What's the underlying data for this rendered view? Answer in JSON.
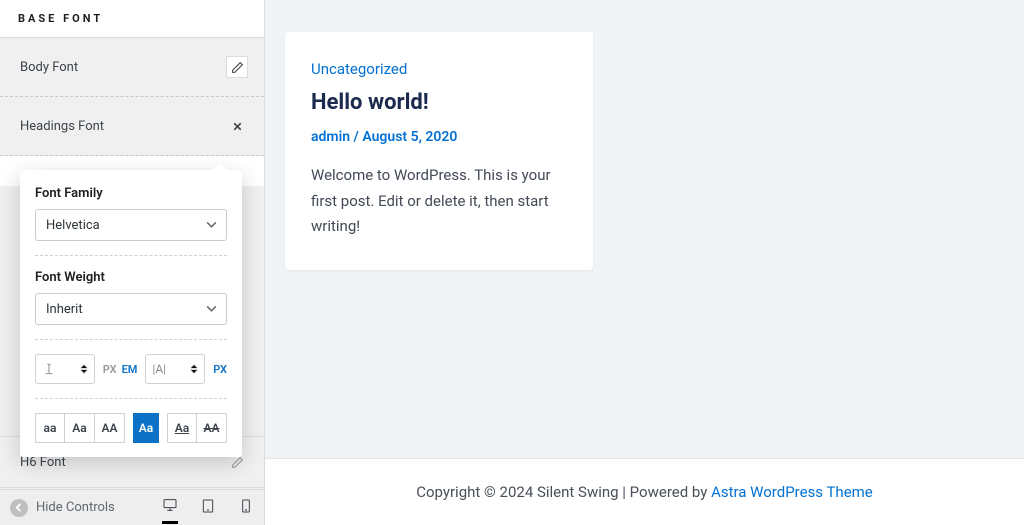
{
  "sidebar": {
    "section_title": "BASE FONT",
    "rows": {
      "body_font": "Body Font",
      "headings_font": "Headings Font",
      "h6_font": "H6 Font"
    }
  },
  "popover": {
    "font_family_label": "Font Family",
    "font_family_value": "Helvetica",
    "font_weight_label": "Font Weight",
    "font_weight_value": "Inherit",
    "units": {
      "px": "PX",
      "em": "EM"
    },
    "spacing_placeholder": "|A|",
    "case": {
      "aa": "aa",
      "Aa": "Aa",
      "AA": "AA"
    }
  },
  "device_bar": {
    "hide_controls": "Hide Controls"
  },
  "post": {
    "category": "Uncategorized",
    "title": "Hello world!",
    "author": "admin",
    "sep": " / ",
    "date": "August 5, 2020",
    "excerpt": "Welcome to WordPress. This is your first post. Edit or delete it, then start writing!"
  },
  "footer": {
    "text": "Copyright © 2024 Silent Swing | Powered by ",
    "link": "Astra WordPress Theme"
  }
}
